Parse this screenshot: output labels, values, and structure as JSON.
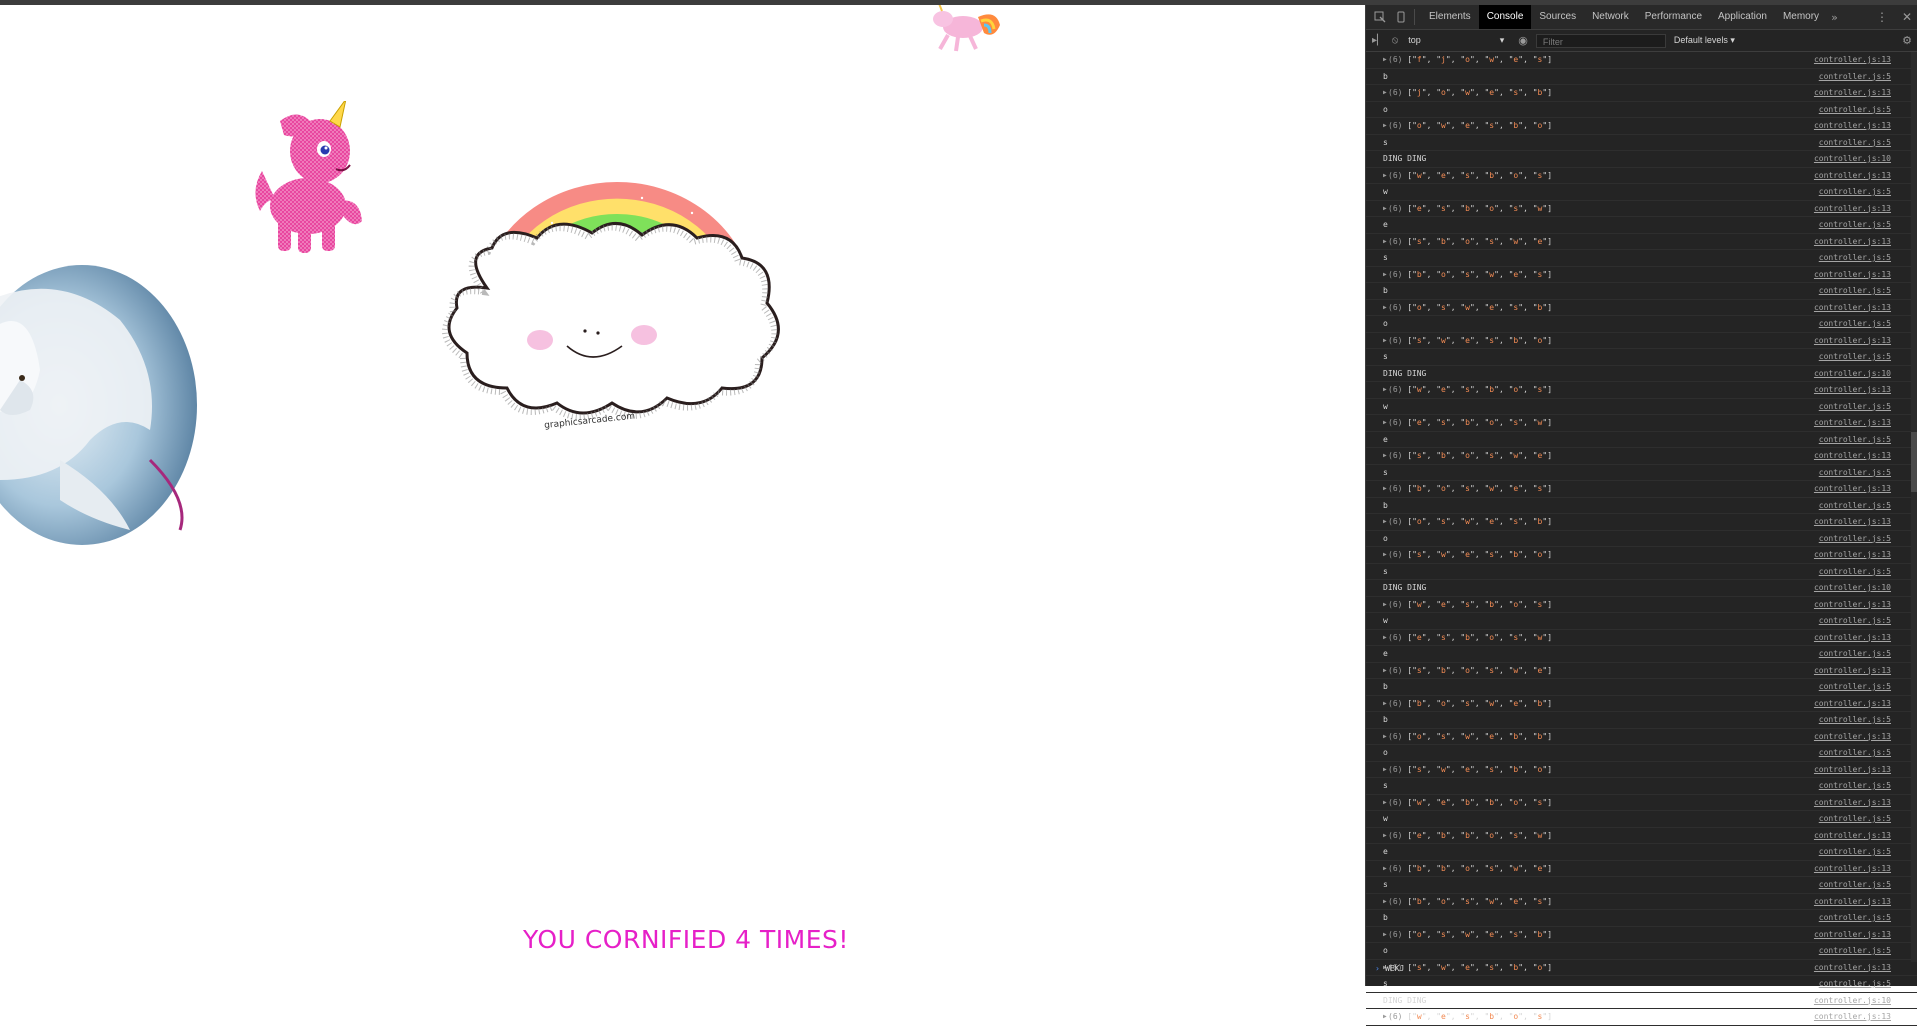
{
  "page": {
    "cornified_message": "YOU CORNIFIED 4 TIMES!",
    "rainbow_watermark": "graphicsarcade.com"
  },
  "devtools": {
    "tabs": [
      {
        "label": "Elements",
        "active": false
      },
      {
        "label": "Console",
        "active": true
      },
      {
        "label": "Sources",
        "active": false
      },
      {
        "label": "Network",
        "active": false
      },
      {
        "label": "Performance",
        "active": false
      },
      {
        "label": "Application",
        "active": false
      },
      {
        "label": "Memory",
        "active": false
      }
    ],
    "more_tabs_icon": "»",
    "context": "top",
    "filter_placeholder": "Filter",
    "levels_label": "Default levels",
    "prompt_input": "WEKJ",
    "log": [
      {
        "kind": "array",
        "count": "(6)",
        "items": [
          "f",
          "j",
          "o",
          "w",
          "e",
          "s"
        ],
        "src": "controller.js:13"
      },
      {
        "kind": "text",
        "text": "b",
        "src": "controller.js:5"
      },
      {
        "kind": "array",
        "count": "(6)",
        "items": [
          "j",
          "o",
          "w",
          "e",
          "s",
          "b"
        ],
        "src": "controller.js:13"
      },
      {
        "kind": "text",
        "text": "o",
        "src": "controller.js:5"
      },
      {
        "kind": "array",
        "count": "(6)",
        "items": [
          "o",
          "w",
          "e",
          "s",
          "b",
          "o"
        ],
        "src": "controller.js:13"
      },
      {
        "kind": "text",
        "text": "s",
        "src": "controller.js:5"
      },
      {
        "kind": "text",
        "text": "DING DING",
        "src": "controller.js:10"
      },
      {
        "kind": "array",
        "count": "(6)",
        "items": [
          "w",
          "e",
          "s",
          "b",
          "o",
          "s"
        ],
        "src": "controller.js:13"
      },
      {
        "kind": "text",
        "text": "w",
        "src": "controller.js:5"
      },
      {
        "kind": "array",
        "count": "(6)",
        "items": [
          "e",
          "s",
          "b",
          "o",
          "s",
          "w"
        ],
        "src": "controller.js:13"
      },
      {
        "kind": "text",
        "text": "e",
        "src": "controller.js:5"
      },
      {
        "kind": "array",
        "count": "(6)",
        "items": [
          "s",
          "b",
          "o",
          "s",
          "w",
          "e"
        ],
        "src": "controller.js:13"
      },
      {
        "kind": "text",
        "text": "s",
        "src": "controller.js:5"
      },
      {
        "kind": "array",
        "count": "(6)",
        "items": [
          "b",
          "o",
          "s",
          "w",
          "e",
          "s"
        ],
        "src": "controller.js:13"
      },
      {
        "kind": "text",
        "text": "b",
        "src": "controller.js:5"
      },
      {
        "kind": "array",
        "count": "(6)",
        "items": [
          "o",
          "s",
          "w",
          "e",
          "s",
          "b"
        ],
        "src": "controller.js:13"
      },
      {
        "kind": "text",
        "text": "o",
        "src": "controller.js:5"
      },
      {
        "kind": "array",
        "count": "(6)",
        "items": [
          "s",
          "w",
          "e",
          "s",
          "b",
          "o"
        ],
        "src": "controller.js:13"
      },
      {
        "kind": "text",
        "text": "s",
        "src": "controller.js:5"
      },
      {
        "kind": "text",
        "text": "DING DING",
        "src": "controller.js:10"
      },
      {
        "kind": "array",
        "count": "(6)",
        "items": [
          "w",
          "e",
          "s",
          "b",
          "o",
          "s"
        ],
        "src": "controller.js:13"
      },
      {
        "kind": "text",
        "text": "w",
        "src": "controller.js:5"
      },
      {
        "kind": "array",
        "count": "(6)",
        "items": [
          "e",
          "s",
          "b",
          "o",
          "s",
          "w"
        ],
        "src": "controller.js:13"
      },
      {
        "kind": "text",
        "text": "e",
        "src": "controller.js:5"
      },
      {
        "kind": "array",
        "count": "(6)",
        "items": [
          "s",
          "b",
          "o",
          "s",
          "w",
          "e"
        ],
        "src": "controller.js:13"
      },
      {
        "kind": "text",
        "text": "s",
        "src": "controller.js:5"
      },
      {
        "kind": "array",
        "count": "(6)",
        "items": [
          "b",
          "o",
          "s",
          "w",
          "e",
          "s"
        ],
        "src": "controller.js:13"
      },
      {
        "kind": "text",
        "text": "b",
        "src": "controller.js:5"
      },
      {
        "kind": "array",
        "count": "(6)",
        "items": [
          "o",
          "s",
          "w",
          "e",
          "s",
          "b"
        ],
        "src": "controller.js:13"
      },
      {
        "kind": "text",
        "text": "o",
        "src": "controller.js:5"
      },
      {
        "kind": "array",
        "count": "(6)",
        "items": [
          "s",
          "w",
          "e",
          "s",
          "b",
          "o"
        ],
        "src": "controller.js:13"
      },
      {
        "kind": "text",
        "text": "s",
        "src": "controller.js:5"
      },
      {
        "kind": "text",
        "text": "DING DING",
        "src": "controller.js:10"
      },
      {
        "kind": "array",
        "count": "(6)",
        "items": [
          "w",
          "e",
          "s",
          "b",
          "o",
          "s"
        ],
        "src": "controller.js:13"
      },
      {
        "kind": "text",
        "text": "w",
        "src": "controller.js:5"
      },
      {
        "kind": "array",
        "count": "(6)",
        "items": [
          "e",
          "s",
          "b",
          "o",
          "s",
          "w"
        ],
        "src": "controller.js:13"
      },
      {
        "kind": "text",
        "text": "e",
        "src": "controller.js:5"
      },
      {
        "kind": "array",
        "count": "(6)",
        "items": [
          "s",
          "b",
          "o",
          "s",
          "w",
          "e"
        ],
        "src": "controller.js:13"
      },
      {
        "kind": "text",
        "text": "b",
        "src": "controller.js:5"
      },
      {
        "kind": "array",
        "count": "(6)",
        "items": [
          "b",
          "o",
          "s",
          "w",
          "e",
          "b"
        ],
        "src": "controller.js:13"
      },
      {
        "kind": "text",
        "text": "b",
        "src": "controller.js:5"
      },
      {
        "kind": "array",
        "count": "(6)",
        "items": [
          "o",
          "s",
          "w",
          "e",
          "b",
          "b"
        ],
        "src": "controller.js:13"
      },
      {
        "kind": "text",
        "text": "o",
        "src": "controller.js:5"
      },
      {
        "kind": "array",
        "count": "(6)",
        "items": [
          "s",
          "w",
          "e",
          "s",
          "b",
          "o"
        ],
        "src": "controller.js:13"
      },
      {
        "kind": "text",
        "text": "s",
        "src": "controller.js:5"
      },
      {
        "kind": "array",
        "count": "(6)",
        "items": [
          "w",
          "e",
          "b",
          "b",
          "o",
          "s"
        ],
        "src": "controller.js:13"
      },
      {
        "kind": "text",
        "text": "w",
        "src": "controller.js:5"
      },
      {
        "kind": "array",
        "count": "(6)",
        "items": [
          "e",
          "b",
          "b",
          "o",
          "s",
          "w"
        ],
        "src": "controller.js:13"
      },
      {
        "kind": "text",
        "text": "e",
        "src": "controller.js:5"
      },
      {
        "kind": "array",
        "count": "(6)",
        "items": [
          "b",
          "b",
          "o",
          "s",
          "w",
          "e"
        ],
        "src": "controller.js:13"
      },
      {
        "kind": "text",
        "text": "s",
        "src": "controller.js:5"
      },
      {
        "kind": "array",
        "count": "(6)",
        "items": [
          "b",
          "o",
          "s",
          "w",
          "e",
          "s"
        ],
        "src": "controller.js:13"
      },
      {
        "kind": "text",
        "text": "b",
        "src": "controller.js:5"
      },
      {
        "kind": "array",
        "count": "(6)",
        "items": [
          "o",
          "s",
          "w",
          "e",
          "s",
          "b"
        ],
        "src": "controller.js:13"
      },
      {
        "kind": "text",
        "text": "o",
        "src": "controller.js:5"
      },
      {
        "kind": "array",
        "count": "(6)",
        "items": [
          "s",
          "w",
          "e",
          "s",
          "b",
          "o"
        ],
        "src": "controller.js:13"
      },
      {
        "kind": "text",
        "text": "s",
        "src": "controller.js:5"
      },
      {
        "kind": "text",
        "text": "DING DING",
        "src": "controller.js:10"
      },
      {
        "kind": "array",
        "count": "(6)",
        "items": [
          "w",
          "e",
          "s",
          "b",
          "o",
          "s"
        ],
        "src": "controller.js:13"
      }
    ]
  },
  "colors": {
    "cornified_text": "#e620c8",
    "console_string": "#f28b54",
    "devtools_bg": "#242424"
  }
}
